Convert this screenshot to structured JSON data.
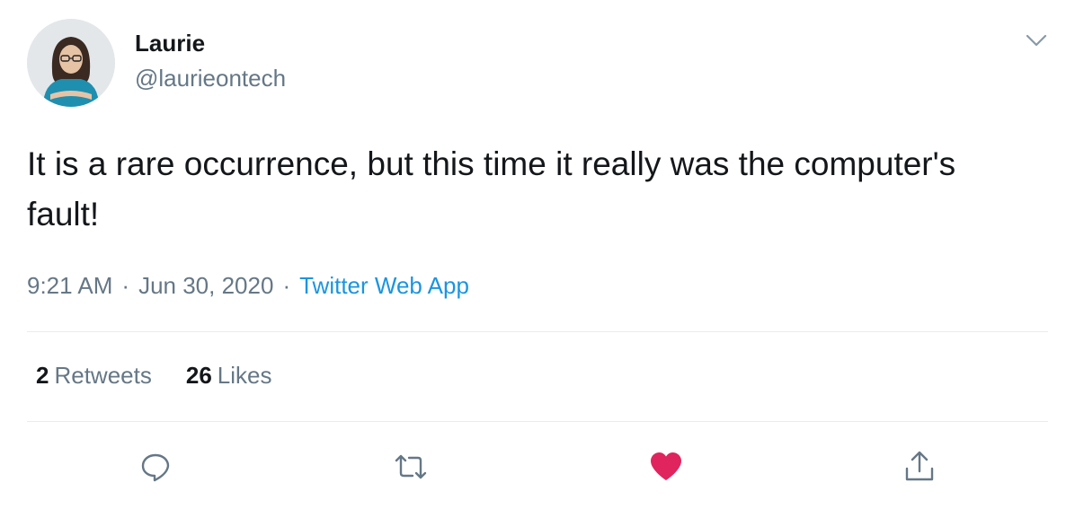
{
  "author": {
    "name": "Laurie",
    "handle": "@laurieontech",
    "avatar_icon": "profile-photo"
  },
  "tweet": {
    "text": "It is a rare occurrence, but this time it really was the computer's fault!",
    "time": "9:21 AM",
    "separator": "·",
    "date": "Jun 30, 2020",
    "source": "Twitter Web App"
  },
  "stats": {
    "retweets_count": "2",
    "retweets_label": "Retweets",
    "likes_count": "26",
    "likes_label": "Likes"
  },
  "actions": {
    "reply_icon": "speech-bubble-icon",
    "retweet_icon": "retweet-arrows-icon",
    "like_icon": "heart-icon",
    "share_icon": "share-upload-icon"
  },
  "colors": {
    "text_primary": "#14171a",
    "text_secondary": "#657786",
    "link": "#1b95e0",
    "like_active": "#e0245e",
    "divider": "#e6ecf0"
  }
}
